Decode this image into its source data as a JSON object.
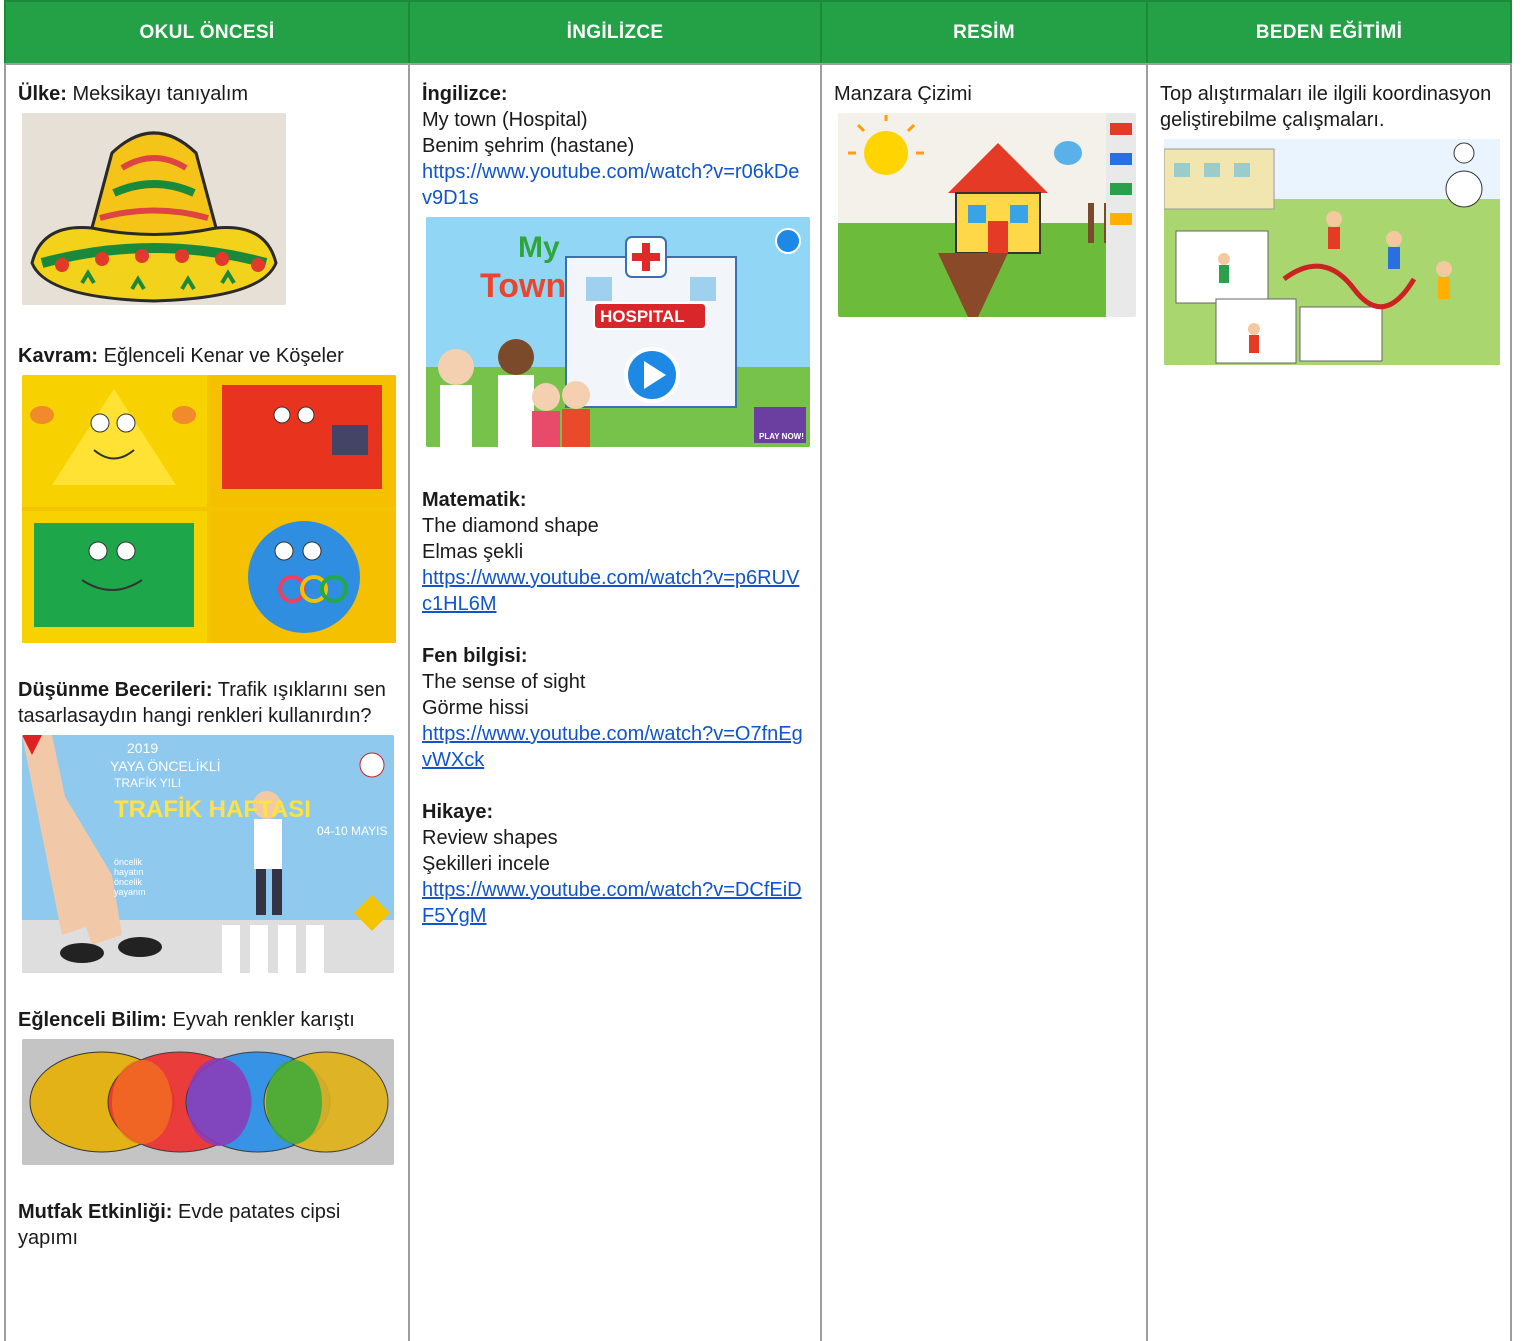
{
  "headers": [
    "OKUL ÖNCESİ",
    "İNGİLİZCE",
    "RESİM",
    "BEDEN EĞİTİMİ"
  ],
  "col1": {
    "ulke": {
      "label": "Ülke:",
      "text": "Meksikayı tanıyalım"
    },
    "kavram": {
      "label": "Kavram:",
      "text": "Eğlenceli Kenar ve Köşeler"
    },
    "dusunme": {
      "label": "Düşünme Becerileri:",
      "text": "Trafik ışıklarını sen tasarlasaydın hangi renkleri kullanırdın?"
    },
    "bilim": {
      "label": "Eğlenceli Bilim:",
      "text": "Eyvah renkler karıştı"
    },
    "mutfak": {
      "label": "Mutfak Etkinliği:",
      "text": "Evde patates cipsi yapımı"
    },
    "traffic_img": {
      "year": "2019",
      "line1": "YAYA ÖNCELİKLİ",
      "line2": "TRAFİK YILI",
      "big": "TRAFİK HAFTASI",
      "dates": "04-10 MAYIS",
      "slogan1": "öncelik",
      "slogan2": "hayatın",
      "slogan3": "öncelik",
      "slogan4": "yayanın"
    }
  },
  "col2": {
    "ingilizce": {
      "label": "İngilizce:",
      "line1": "My town (Hospital)",
      "line2": "Benim şehrim (hastane)",
      "url": "https://www.youtube.com/watch?v=r06kDev9D1s"
    },
    "hospital_img": {
      "my": "My",
      "town": "Town",
      "sign": "HOSPITAL",
      "play": "PLAY NOW!"
    },
    "matematik": {
      "label": "Matematik:",
      "line1": "The diamond shape",
      "line2": "Elmas şekli",
      "url": "https://www.youtube.com/watch?v=p6RUVc1HL6M"
    },
    "fen": {
      "label": "Fen bilgisi:",
      "line1": "The sense of sight",
      "line2": "Görme hissi",
      "url": "https://www.youtube.com/watch?v=O7fnEgvWXck"
    },
    "hikaye": {
      "label": "Hikaye:",
      "line1": "Review shapes",
      "line2": "Şekilleri incele",
      "url": "https://www.youtube.com/watch?v=DCfEiDF5YgM"
    }
  },
  "col3": {
    "text": "Manzara Çizimi"
  },
  "col4": {
    "text": "Top alıştırmaları ile ilgili koordinasyon geliştirebilme çalışmaları."
  },
  "colors": {
    "header_green": "#24a047",
    "link_blue": "#1155cc",
    "border_gray": "#9e9e9e"
  }
}
